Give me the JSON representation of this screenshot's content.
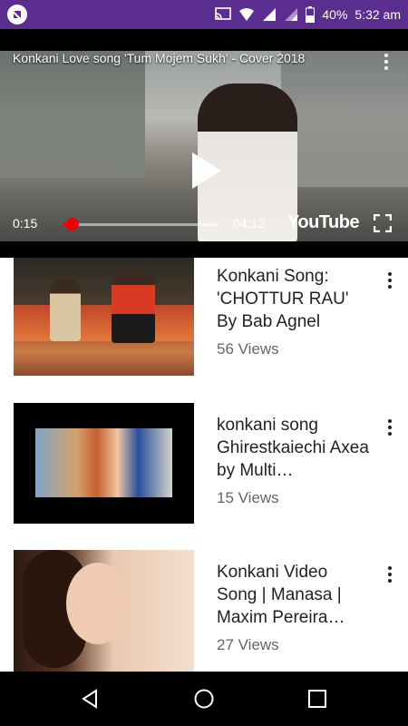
{
  "status_bar": {
    "battery": "40%",
    "time": "5:32 am",
    "background": "#5b2d8e"
  },
  "player": {
    "title": "Konkani Love song 'Tum Mojem Sukh' - Cover 2018",
    "current_time": "0:15",
    "duration": "04:12",
    "brand": "YouTube",
    "progress_fraction": 0.06,
    "accent": "#e00000"
  },
  "videos": [
    {
      "title": "Konkani Song: 'CHOTTUR RAU' By Bab Agnel",
      "views": "56 Views"
    },
    {
      "title": "konkani song Ghirestkaiechi Axea by Multi…",
      "views": "15 Views"
    },
    {
      "title": "Konkani Video Song |  Manasa | Maxim Pereira…",
      "views": "27 Views"
    }
  ],
  "icons": {
    "status": [
      "app-icon",
      "cast-icon",
      "wifi-icon",
      "signal-icon",
      "battery-icon"
    ],
    "player": [
      "more-icon",
      "play-icon",
      "fullscreen-icon"
    ],
    "nav": [
      "back-icon",
      "home-icon",
      "recents-icon"
    ]
  }
}
